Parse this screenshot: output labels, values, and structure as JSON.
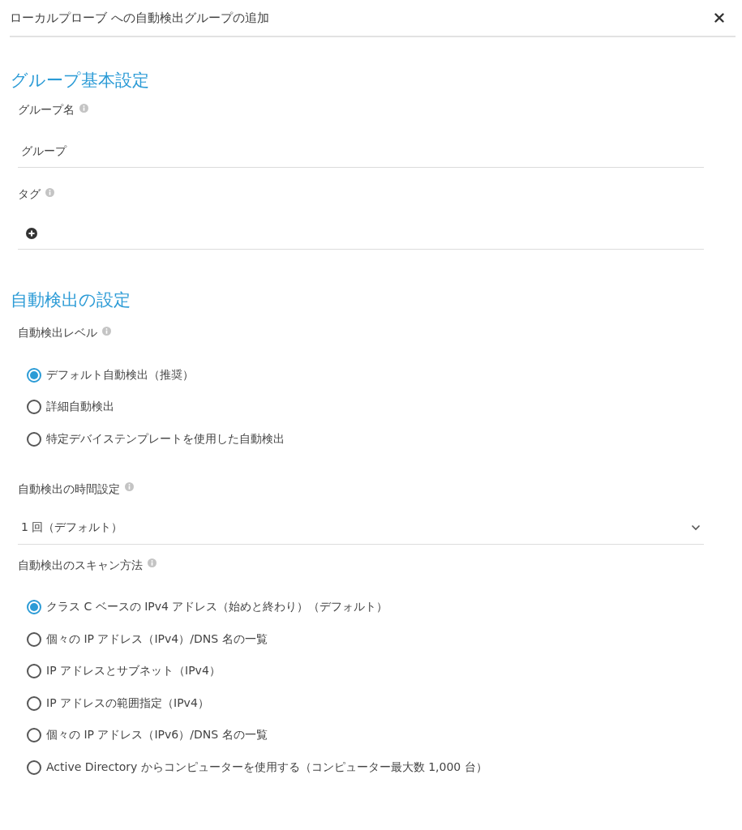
{
  "dialog": {
    "title": "ローカルプローブ への自動検出グループの追加"
  },
  "sections": [
    {
      "heading": "グループ基本設定",
      "fields": [
        {
          "kind": "text",
          "label": "グループ名",
          "value": "グループ"
        },
        {
          "kind": "tags",
          "label": "タグ"
        }
      ]
    },
    {
      "heading": "自動検出の設定",
      "fields": [
        {
          "kind": "radio",
          "label": "自動検出レベル",
          "options": [
            {
              "label": "デフォルト自動検出（推奨）",
              "selected": true
            },
            {
              "label": "詳細自動検出",
              "selected": false
            },
            {
              "label": "特定デバイステンプレートを使用した自動検出",
              "selected": false
            }
          ]
        },
        {
          "kind": "select",
          "label": "自動検出の時間設定",
          "value": "1 回（デフォルト）"
        },
        {
          "kind": "radio",
          "label": "自動検出のスキャン方法",
          "options": [
            {
              "label": "クラス C ベースの IPv4 アドレス（始めと終わり）（デフォルト）",
              "selected": true
            },
            {
              "label": "個々の IP アドレス（IPv4）/DNS 名の一覧",
              "selected": false
            },
            {
              "label": "IP アドレスとサブネット（IPv4）",
              "selected": false
            },
            {
              "label": "IP アドレスの範囲指定（IPv4）",
              "selected": false
            },
            {
              "label": "個々の IP アドレス（IPv6）/DNS 名の一覧",
              "selected": false
            },
            {
              "label": "Active Directory からコンピューターを使用する（コンピューター最大数 1,000 台）",
              "selected": false
            }
          ]
        }
      ]
    }
  ]
}
